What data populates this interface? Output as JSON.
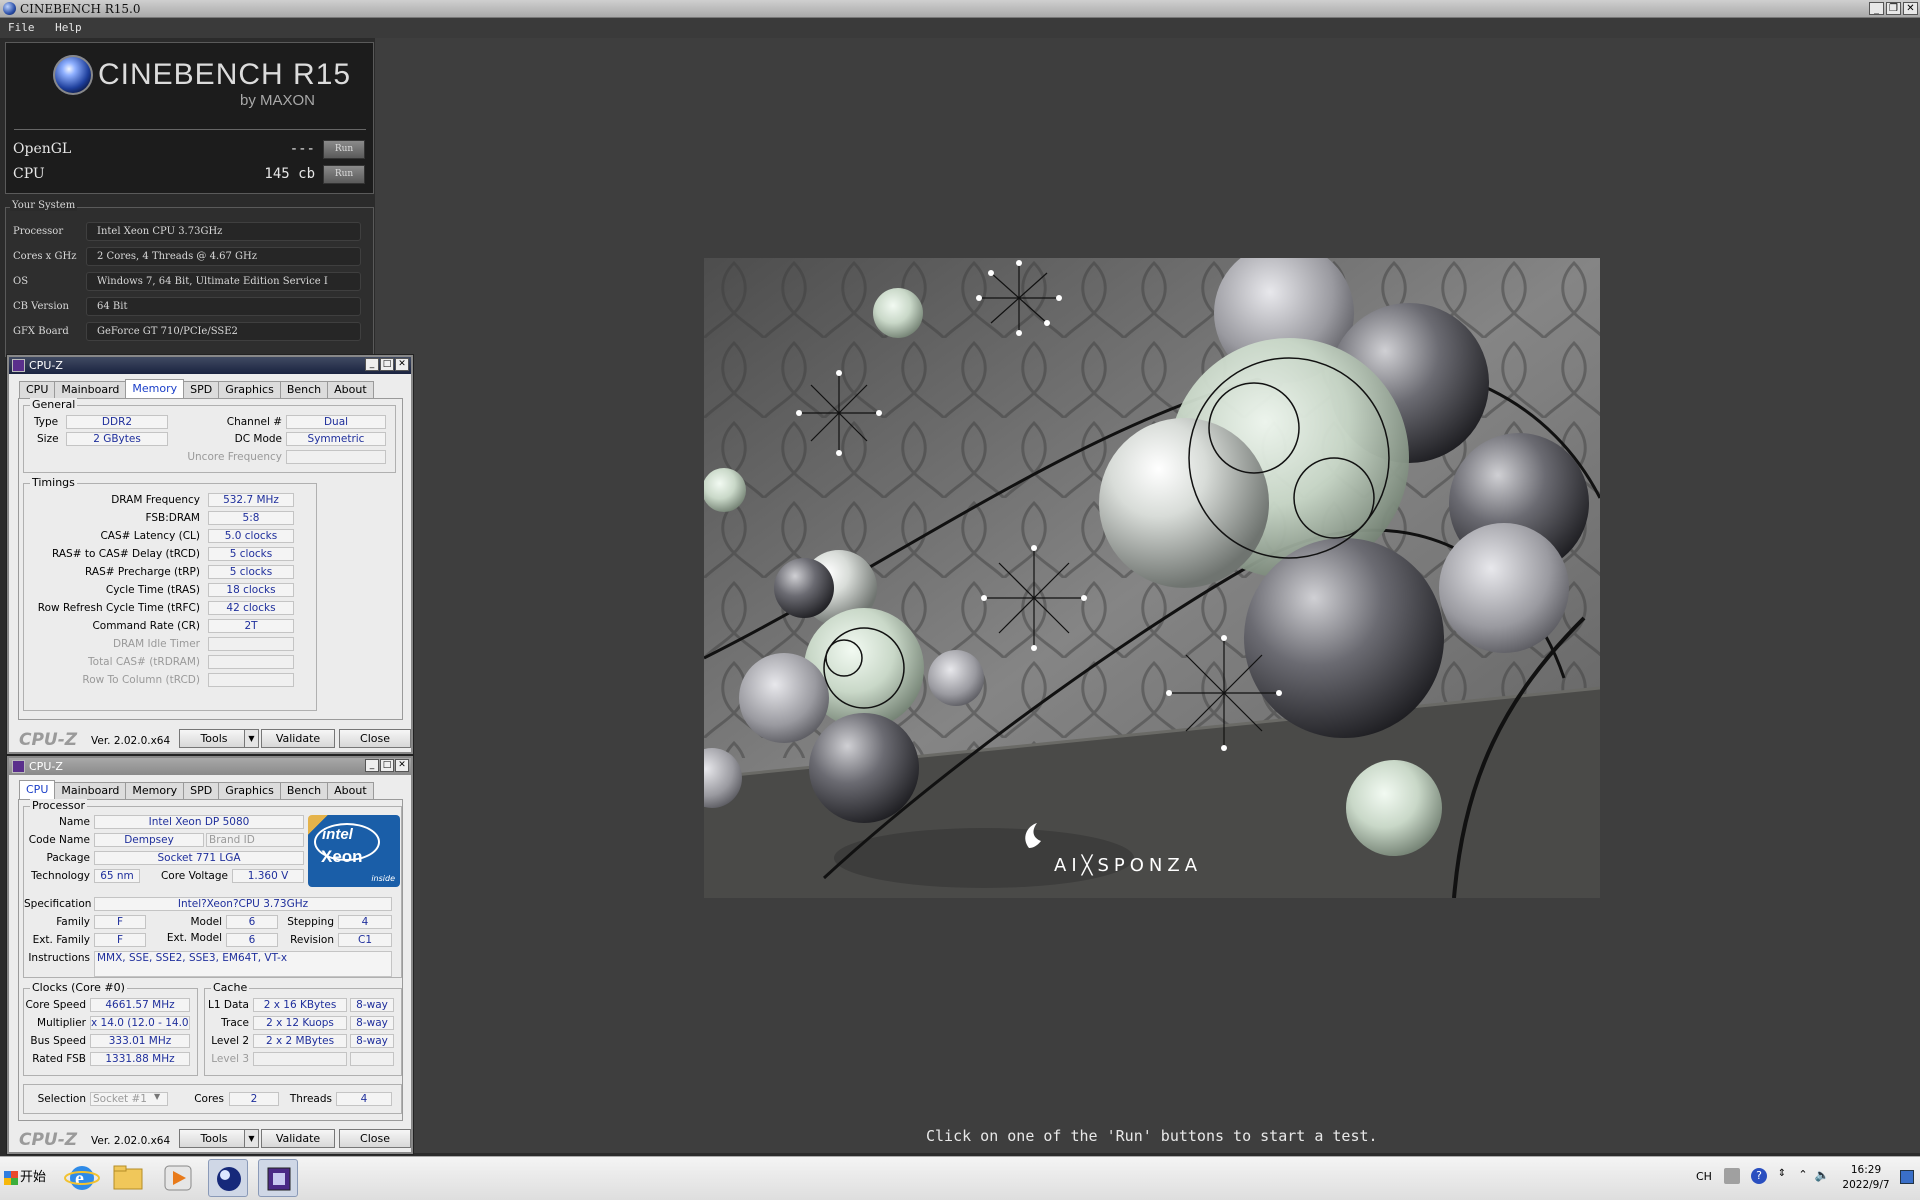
{
  "cinebench": {
    "window_title": "CINEBENCH R15.0",
    "menu": [
      "File",
      "Help"
    ],
    "logo_text": "CINEBENCH R15",
    "logo_by": "by MAXON",
    "tests": [
      {
        "label": "OpenGL",
        "value": "---",
        "run": "Run"
      },
      {
        "label": "CPU",
        "value": "145 cb",
        "run": "Run"
      }
    ],
    "system_title": "Your System",
    "system": [
      {
        "key": "Processor",
        "value": "Intel Xeon CPU 3.73GHz"
      },
      {
        "key": "Cores x GHz",
        "value": "2 Cores, 4 Threads @ 4.67 GHz"
      },
      {
        "key": "OS",
        "value": "Windows 7, 64 Bit, Ultimate Edition Service I"
      },
      {
        "key": "CB Version",
        "value": "64 Bit"
      },
      {
        "key": "GFX Board",
        "value": "GeForce GT 710/PCIe/SSE2"
      }
    ],
    "render_watermark": "AI╳SPONZA",
    "status_message": "Click on one of the 'Run' buttons to start a test."
  },
  "cpuz_common": {
    "title": "CPU-Z",
    "tabs": [
      "CPU",
      "Mainboard",
      "Memory",
      "SPD",
      "Graphics",
      "Bench",
      "About"
    ],
    "brand": "CPU-Z",
    "version": "Ver. 2.02.0.x64",
    "tools": "Tools",
    "validate": "Validate",
    "close": "Close"
  },
  "memory": {
    "active_tab": "Memory",
    "general_title": "General",
    "type_label": "Type",
    "type": "DDR2",
    "size_label": "Size",
    "size": "2 GBytes",
    "channel_label": "Channel #",
    "channel": "Dual",
    "dcmode_label": "DC Mode",
    "dcmode": "Symmetric",
    "uncore_label": "Uncore Frequency",
    "uncore": "",
    "timings_title": "Timings",
    "timings": [
      {
        "label": "DRAM Frequency",
        "value": "532.7 MHz",
        "dim": false
      },
      {
        "label": "FSB:DRAM",
        "value": "5:8",
        "dim": false
      },
      {
        "label": "CAS# Latency (CL)",
        "value": "5.0 clocks",
        "dim": false
      },
      {
        "label": "RAS# to CAS# Delay (tRCD)",
        "value": "5 clocks",
        "dim": false
      },
      {
        "label": "RAS# Precharge (tRP)",
        "value": "5 clocks",
        "dim": false
      },
      {
        "label": "Cycle Time (tRAS)",
        "value": "18 clocks",
        "dim": false
      },
      {
        "label": "Row Refresh Cycle Time (tRFC)",
        "value": "42 clocks",
        "dim": false
      },
      {
        "label": "Command Rate (CR)",
        "value": "2T",
        "dim": false
      },
      {
        "label": "DRAM Idle Timer",
        "value": "",
        "dim": true
      },
      {
        "label": "Total CAS# (tRDRAM)",
        "value": "",
        "dim": true
      },
      {
        "label": "Row To Column (tRCD)",
        "value": "",
        "dim": true
      }
    ]
  },
  "cpu": {
    "active_tab": "CPU",
    "processor_title": "Processor",
    "name_label": "Name",
    "name": "Intel Xeon DP 5080",
    "codename_label": "Code Name",
    "codename": "Dempsey",
    "brandid_label": "Brand ID",
    "package_label": "Package",
    "package": "Socket 771 LGA",
    "tech_label": "Technology",
    "tech": "65 nm",
    "voltage_label": "Core Voltage",
    "voltage": "1.360 V",
    "spec_label": "Specification",
    "spec": "Intel?Xeon?CPU 3.73GHz",
    "family_label": "Family",
    "family": "F",
    "model_label": "Model",
    "model": "6",
    "stepping_label": "Stepping",
    "stepping": "4",
    "extfamily_label": "Ext. Family",
    "extfamily": "F",
    "extmodel_label": "Ext. Model",
    "extmodel": "6",
    "revision_label": "Revision",
    "revision": "C1",
    "instr_label": "Instructions",
    "instr": "MMX, SSE, SSE2, SSE3, EM64T, VT-x",
    "clocks_title": "Clocks (Core #0)",
    "corespeed_label": "Core Speed",
    "corespeed": "4661.57 MHz",
    "mult_label": "Multiplier",
    "mult": "x 14.0 (12.0 - 14.0)",
    "bus_label": "Bus Speed",
    "bus": "333.01 MHz",
    "fsb_label": "Rated FSB",
    "fsb": "1331.88 MHz",
    "cache_title": "Cache",
    "l1_label": "L1 Data",
    "l1": "2 x 16 KBytes",
    "l1way": "8-way",
    "trace_label": "Trace",
    "trace": "2 x 12 Kuops",
    "traceway": "8-way",
    "l2_label": "Level 2",
    "l2": "2 x 2 MBytes",
    "l2way": "8-way",
    "l3_label": "Level 3",
    "selection_label": "Selection",
    "selection": "Socket #1",
    "cores_label": "Cores",
    "cores": "2",
    "threads_label": "Threads",
    "threads": "4",
    "logo_intel": "intel",
    "logo_xeon": "Xeon",
    "logo_inside": "inside"
  },
  "taskbar": {
    "start": "开始",
    "lang": "CH",
    "time": "16:29",
    "date": "2022/9/7"
  }
}
